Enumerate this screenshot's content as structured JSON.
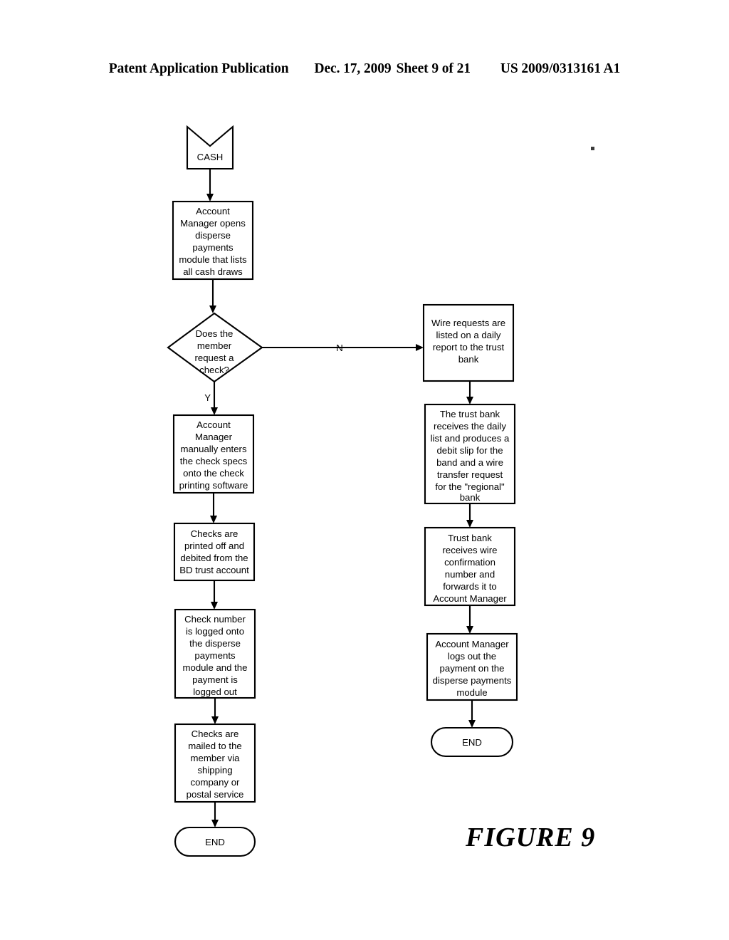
{
  "header": {
    "publication": "Patent Application Publication",
    "date": "Dec. 17, 2009",
    "sheet": "Sheet 9 of 21",
    "patent_number": "US 2009/0313161 A1"
  },
  "figure": {
    "caption": "FIGURE 9"
  },
  "diagram": {
    "start": {
      "label": "CASH"
    },
    "decision": {
      "lines": [
        "Does the",
        "member",
        "request a",
        "check?"
      ],
      "yes_label": "Y",
      "no_label": "N"
    },
    "left_branch": [
      {
        "id": "open-module",
        "lines": [
          "Account",
          "Manager opens",
          "disperse",
          "payments",
          "module that lists",
          "all cash draws"
        ]
      },
      {
        "id": "enter-check-specs",
        "lines": [
          "Account",
          "Manager",
          "manually enters",
          "the check specs",
          "onto the check",
          "printing software"
        ]
      },
      {
        "id": "print-checks",
        "lines": [
          "Checks are",
          "printed off and",
          "debited from the",
          "BD trust account"
        ]
      },
      {
        "id": "log-check-number",
        "lines": [
          "Check number",
          "is logged onto",
          "the disperse",
          "payments",
          "module and the",
          "payment is",
          "logged out"
        ]
      },
      {
        "id": "mail-checks",
        "lines": [
          "Checks are",
          "mailed to the",
          "member via",
          "shipping",
          "company or",
          "postal service"
        ]
      }
    ],
    "left_end": {
      "label": "END"
    },
    "right_branch": [
      {
        "id": "wire-requests-listed",
        "lines": [
          "Wire requests are",
          "listed on a daily",
          "report to the trust",
          "bank"
        ]
      },
      {
        "id": "trust-bank-produces",
        "lines": [
          "The trust bank",
          "receives the daily",
          "list and produces a",
          "debit slip for the",
          "band and a wire",
          "transfer  request",
          "for the \"regional\"",
          "bank"
        ]
      },
      {
        "id": "wire-confirmation",
        "lines": [
          "Trust bank",
          "receives wire",
          "confirmation",
          "number and",
          "forwards it to",
          "Account Manager"
        ]
      },
      {
        "id": "log-out-payment",
        "lines": [
          "Account Manager",
          "logs out the",
          "payment on the",
          "disperse payments",
          "module"
        ]
      }
    ],
    "right_end": {
      "label": "END"
    }
  }
}
